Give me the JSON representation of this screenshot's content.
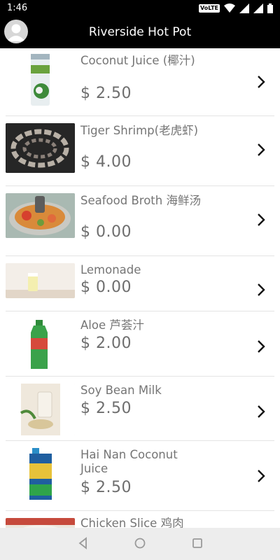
{
  "status": {
    "time": "1:46",
    "volte": "VoLTE"
  },
  "header": {
    "title": "Riverside Hot Pot"
  },
  "items": [
    {
      "name": "Coconut Juice (椰汁)",
      "price": "$ 2.50"
    },
    {
      "name": "Tiger Shrimp(老虎虾)",
      "price": "$ 4.00"
    },
    {
      "name": "Seafood Broth 海鲜汤",
      "price": "$ 0.00"
    },
    {
      "name": "Lemonade",
      "price": "$ 0.00"
    },
    {
      "name": "Aloe 芦荟汁",
      "price": "$ 2.00"
    },
    {
      "name": "Soy Bean Milk",
      "price": "$ 2.50"
    },
    {
      "name": "Hai Nan Coconut Juice",
      "price": "$ 2.50"
    },
    {
      "name": "Chicken Slice 鸡肉",
      "price": ""
    }
  ]
}
